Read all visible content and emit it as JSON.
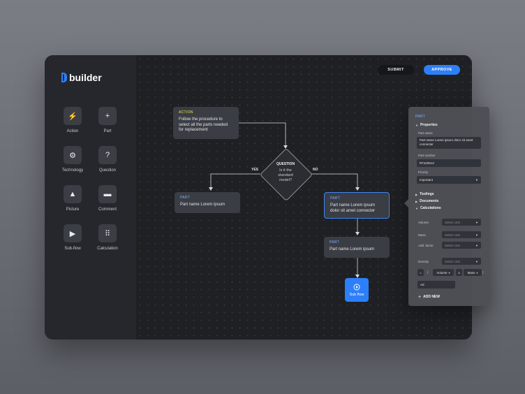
{
  "brand": {
    "name": "builder",
    "accent": "#2d7ff9"
  },
  "toolbar": {
    "submit_label": "SUBMIT",
    "approve_label": "APPROVE"
  },
  "tools": [
    {
      "label": "Action",
      "icon": "bolt-icon",
      "glyph": "⚡"
    },
    {
      "label": "Part",
      "icon": "plus-square-icon",
      "glyph": "+"
    },
    {
      "label": "Technology",
      "icon": "gear-icon",
      "glyph": "⚙"
    },
    {
      "label": "Question",
      "icon": "question-icon",
      "glyph": "?"
    },
    {
      "label": "Picture",
      "icon": "image-icon",
      "glyph": "▲"
    },
    {
      "label": "Comment",
      "icon": "comment-icon",
      "glyph": "▬"
    },
    {
      "label": "Sub-flow",
      "icon": "play-circle-icon",
      "glyph": "▶"
    },
    {
      "label": "Calculation",
      "icon": "grid-icon",
      "glyph": "⠿"
    }
  ],
  "flow": {
    "action": {
      "tag": "ACTION",
      "text": "Follow the procedure to select all the parts needed for replacement"
    },
    "question": {
      "tag": "QUESTION",
      "text": "Is it the standard model?",
      "yes": "YES",
      "no": "NO"
    },
    "part_left": {
      "tag": "PART",
      "text": "Part name Lorem ipsum"
    },
    "part_right": {
      "tag": "PART",
      "text": "Part name Lorem ipsum dolor sit amet connecter"
    },
    "part_bottom": {
      "tag": "PART",
      "text": "Part name Lorem ipsum"
    },
    "subflow": {
      "label": "Sub flow"
    }
  },
  "panel": {
    "tag": "PART",
    "properties_title": "Properties",
    "part_name_label": "Part name",
    "part_name_value": "Part name Lorem ipsum dolor sit amet connecter",
    "part_number_label": "Part number",
    "part_number_value": "RT420612",
    "priority_label": "Priority",
    "priority_value": "Important",
    "toolings_title": "Toolings",
    "documents_title": "Documents",
    "calculations_title": "Calculations",
    "calc_rows": [
      {
        "label": "Volume",
        "placeholder": "Select Unit"
      },
      {
        "label": "Mass",
        "placeholder": "Select Unit"
      },
      {
        "label": "Add. factor",
        "placeholder": "Select Unit"
      },
      {
        "label": "Density",
        "placeholder": "Select Unit"
      }
    ],
    "formula": {
      "op1": "=",
      "paren": "(",
      "var1": "Volume",
      "op2": "x",
      "var2": "Mass",
      "close": ")"
    },
    "formula_extra": "Ad",
    "add_new_label": "ADD NEW"
  }
}
